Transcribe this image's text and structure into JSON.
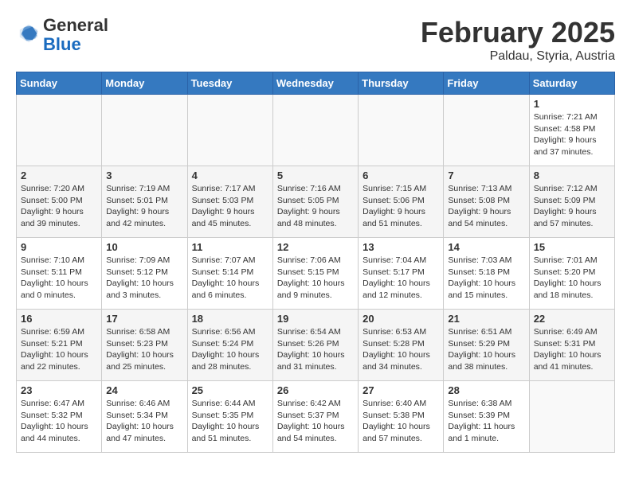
{
  "header": {
    "logo_general": "General",
    "logo_blue": "Blue",
    "month": "February 2025",
    "location": "Paldau, Styria, Austria"
  },
  "days_of_week": [
    "Sunday",
    "Monday",
    "Tuesday",
    "Wednesday",
    "Thursday",
    "Friday",
    "Saturday"
  ],
  "weeks": [
    [
      {
        "day": "",
        "info": ""
      },
      {
        "day": "",
        "info": ""
      },
      {
        "day": "",
        "info": ""
      },
      {
        "day": "",
        "info": ""
      },
      {
        "day": "",
        "info": ""
      },
      {
        "day": "",
        "info": ""
      },
      {
        "day": "1",
        "info": "Sunrise: 7:21 AM\nSunset: 4:58 PM\nDaylight: 9 hours and 37 minutes."
      }
    ],
    [
      {
        "day": "2",
        "info": "Sunrise: 7:20 AM\nSunset: 5:00 PM\nDaylight: 9 hours and 39 minutes."
      },
      {
        "day": "3",
        "info": "Sunrise: 7:19 AM\nSunset: 5:01 PM\nDaylight: 9 hours and 42 minutes."
      },
      {
        "day": "4",
        "info": "Sunrise: 7:17 AM\nSunset: 5:03 PM\nDaylight: 9 hours and 45 minutes."
      },
      {
        "day": "5",
        "info": "Sunrise: 7:16 AM\nSunset: 5:05 PM\nDaylight: 9 hours and 48 minutes."
      },
      {
        "day": "6",
        "info": "Sunrise: 7:15 AM\nSunset: 5:06 PM\nDaylight: 9 hours and 51 minutes."
      },
      {
        "day": "7",
        "info": "Sunrise: 7:13 AM\nSunset: 5:08 PM\nDaylight: 9 hours and 54 minutes."
      },
      {
        "day": "8",
        "info": "Sunrise: 7:12 AM\nSunset: 5:09 PM\nDaylight: 9 hours and 57 minutes."
      }
    ],
    [
      {
        "day": "9",
        "info": "Sunrise: 7:10 AM\nSunset: 5:11 PM\nDaylight: 10 hours and 0 minutes."
      },
      {
        "day": "10",
        "info": "Sunrise: 7:09 AM\nSunset: 5:12 PM\nDaylight: 10 hours and 3 minutes."
      },
      {
        "day": "11",
        "info": "Sunrise: 7:07 AM\nSunset: 5:14 PM\nDaylight: 10 hours and 6 minutes."
      },
      {
        "day": "12",
        "info": "Sunrise: 7:06 AM\nSunset: 5:15 PM\nDaylight: 10 hours and 9 minutes."
      },
      {
        "day": "13",
        "info": "Sunrise: 7:04 AM\nSunset: 5:17 PM\nDaylight: 10 hours and 12 minutes."
      },
      {
        "day": "14",
        "info": "Sunrise: 7:03 AM\nSunset: 5:18 PM\nDaylight: 10 hours and 15 minutes."
      },
      {
        "day": "15",
        "info": "Sunrise: 7:01 AM\nSunset: 5:20 PM\nDaylight: 10 hours and 18 minutes."
      }
    ],
    [
      {
        "day": "16",
        "info": "Sunrise: 6:59 AM\nSunset: 5:21 PM\nDaylight: 10 hours and 22 minutes."
      },
      {
        "day": "17",
        "info": "Sunrise: 6:58 AM\nSunset: 5:23 PM\nDaylight: 10 hours and 25 minutes."
      },
      {
        "day": "18",
        "info": "Sunrise: 6:56 AM\nSunset: 5:24 PM\nDaylight: 10 hours and 28 minutes."
      },
      {
        "day": "19",
        "info": "Sunrise: 6:54 AM\nSunset: 5:26 PM\nDaylight: 10 hours and 31 minutes."
      },
      {
        "day": "20",
        "info": "Sunrise: 6:53 AM\nSunset: 5:28 PM\nDaylight: 10 hours and 34 minutes."
      },
      {
        "day": "21",
        "info": "Sunrise: 6:51 AM\nSunset: 5:29 PM\nDaylight: 10 hours and 38 minutes."
      },
      {
        "day": "22",
        "info": "Sunrise: 6:49 AM\nSunset: 5:31 PM\nDaylight: 10 hours and 41 minutes."
      }
    ],
    [
      {
        "day": "23",
        "info": "Sunrise: 6:47 AM\nSunset: 5:32 PM\nDaylight: 10 hours and 44 minutes."
      },
      {
        "day": "24",
        "info": "Sunrise: 6:46 AM\nSunset: 5:34 PM\nDaylight: 10 hours and 47 minutes."
      },
      {
        "day": "25",
        "info": "Sunrise: 6:44 AM\nSunset: 5:35 PM\nDaylight: 10 hours and 51 minutes."
      },
      {
        "day": "26",
        "info": "Sunrise: 6:42 AM\nSunset: 5:37 PM\nDaylight: 10 hours and 54 minutes."
      },
      {
        "day": "27",
        "info": "Sunrise: 6:40 AM\nSunset: 5:38 PM\nDaylight: 10 hours and 57 minutes."
      },
      {
        "day": "28",
        "info": "Sunrise: 6:38 AM\nSunset: 5:39 PM\nDaylight: 11 hours and 1 minute."
      },
      {
        "day": "",
        "info": ""
      }
    ]
  ]
}
